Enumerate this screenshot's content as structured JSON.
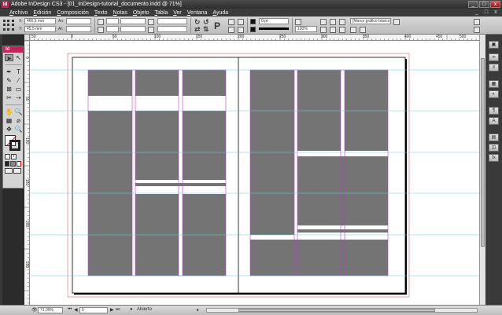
{
  "window": {
    "title": "Adobe InDesign CS3 - [01_InDesign-tutorial_documento.indd @ 71%]",
    "app_badge": "Id",
    "minimize": "_",
    "maximize": "□",
    "close": "x"
  },
  "menu": [
    "Archivo",
    "Edición",
    "Composición",
    "Texto",
    "Notas",
    "Objeto",
    "Tabla",
    "Ver",
    "Ventana",
    "Ayuda"
  ],
  "control": {
    "x_label": "X:",
    "x_value": "466,5 mm",
    "y_label": "Y:",
    "y_value": "45,5 mm",
    "w_label": "An:",
    "h_label": "Al:",
    "stroke_weight": "0 pt",
    "opacity": "100%",
    "frame_style": "[Marco gráfico básico]+"
  },
  "tools_panel": {
    "badge": "Id",
    "tools": [
      "➤",
      "↖",
      "✒",
      "T",
      "✎",
      "⁄",
      "⊠",
      "▭",
      "✂",
      "⇢",
      "✋",
      "🔍",
      "▦",
      "⌀",
      "✥",
      "🔍"
    ]
  },
  "ruler": {
    "h_labels": [
      "50",
      "0",
      "50",
      "100",
      "150",
      "200",
      "250",
      "300",
      "350",
      "400",
      "450",
      "500"
    ],
    "v_labels": [
      "0",
      "50",
      "100",
      "150",
      "200",
      "250"
    ]
  },
  "status": {
    "zoom": "71,09%",
    "page": "5",
    "state": "Abierto"
  },
  "colors": {
    "frame_fill": "#747474",
    "margin_guide": "#b340c6",
    "ruler_guide": "#5ad2dc",
    "bleed_guide": "#e06070",
    "app_accent": "#c0245b"
  }
}
